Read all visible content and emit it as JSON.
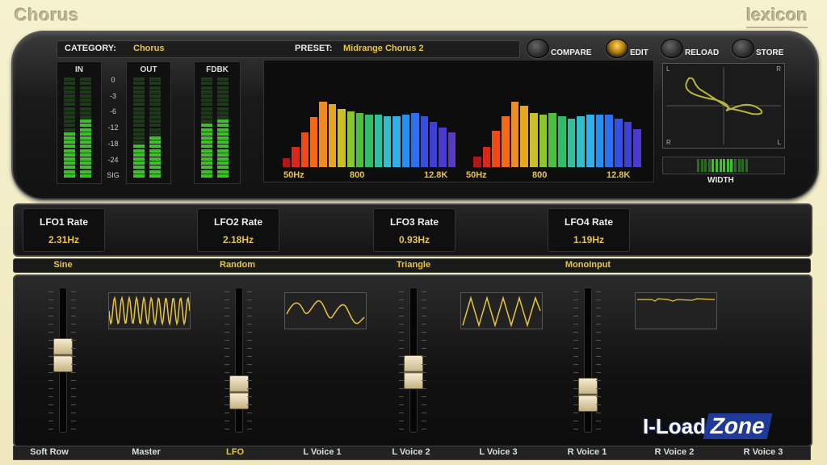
{
  "app": {
    "title": "Chorus",
    "brand": "lexicon"
  },
  "header": {
    "category_label": "CATEGORY:",
    "category_value": "Chorus",
    "preset_label": "PRESET:",
    "preset_value": "Midrange Chorus 2",
    "buttons": [
      {
        "label": "COMPARE",
        "active": false
      },
      {
        "label": "EDIT",
        "active": true
      },
      {
        "label": "RELOAD",
        "active": false
      },
      {
        "label": "STORE",
        "active": false
      }
    ]
  },
  "meters": {
    "in_label": "IN",
    "out_label": "OUT",
    "fdbk_label": "FDBK",
    "scale": [
      "0",
      "-3",
      "-6",
      "-12",
      "-18",
      "-24",
      "SIG"
    ],
    "in_levels": [
      0.45,
      0.58
    ],
    "out_levels": [
      0.35,
      0.4
    ],
    "fdbk_levels": [
      0.55,
      0.58
    ]
  },
  "spectrum": {
    "freq_labels": [
      "50Hz",
      "800",
      "12.8K"
    ],
    "left_bars": [
      0.1,
      0.22,
      0.38,
      0.55,
      0.72,
      0.7,
      0.64,
      0.62,
      0.6,
      0.58,
      0.58,
      0.56,
      0.56,
      0.58,
      0.6,
      0.56,
      0.5,
      0.44,
      0.38
    ],
    "right_bars": [
      0.12,
      0.22,
      0.4,
      0.56,
      0.72,
      0.68,
      0.6,
      0.58,
      0.6,
      0.56,
      0.54,
      0.56,
      0.58,
      0.58,
      0.58,
      0.54,
      0.5,
      0.42
    ]
  },
  "xy_display": {
    "corner_labels": [
      "L",
      "R",
      "R",
      "L"
    ]
  },
  "width": {
    "label": "WIDTH"
  },
  "lfos": [
    {
      "name": "LFO1 Rate",
      "value": "2.31Hz",
      "shape": "Sine"
    },
    {
      "name": "LFO2 Rate",
      "value": "2.18Hz",
      "shape": "Random"
    },
    {
      "name": "LFO3 Rate",
      "value": "0.93Hz",
      "shape": "Triangle"
    },
    {
      "name": "LFO4 Rate",
      "value": "1.19Hz",
      "shape": "MonoInput"
    }
  ],
  "faders": [
    {
      "level": 0.55
    },
    {
      "level": 0.22
    },
    {
      "level": 0.4
    },
    {
      "level": 0.2
    }
  ],
  "bottom_tabs": [
    {
      "label": "Soft Row",
      "active": false
    },
    {
      "label": "Master",
      "active": false
    },
    {
      "label": "LFO",
      "active": true
    },
    {
      "label": "L Voice 1",
      "active": false
    },
    {
      "label": "L Voice 2",
      "active": false
    },
    {
      "label": "L Voice 3",
      "active": false
    },
    {
      "label": "R Voice 1",
      "active": false
    },
    {
      "label": "R Voice 2",
      "active": false
    },
    {
      "label": "R Voice 3",
      "active": false
    }
  ],
  "watermark": {
    "left": "I-Load",
    "right": "Zone"
  },
  "colors": {
    "accent": "#e8c53a",
    "meter_green": "#3fbf2a",
    "panel": "#141414"
  }
}
